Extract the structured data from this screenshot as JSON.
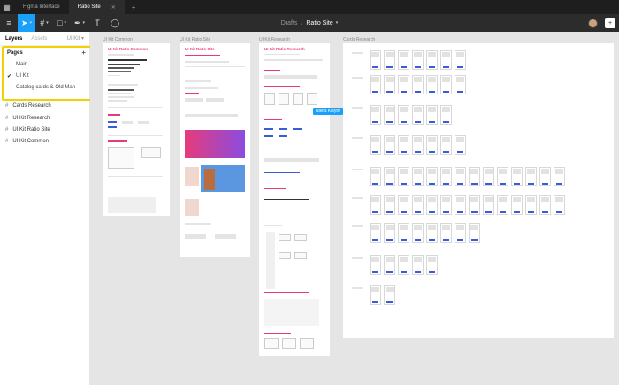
{
  "tabs": [
    {
      "label": "Figma Interface",
      "active": false
    },
    {
      "label": "Ratio Site",
      "active": true
    }
  ],
  "breadcrumb": {
    "project": "Drafts",
    "separator": "/",
    "file": "Ratio Site"
  },
  "layers_panel": {
    "tab_layers": "Layers",
    "tab_assets": "Assets",
    "page_dropdown": "UI Kit",
    "pages_header": "Pages",
    "pages": [
      "Main",
      "UI Kit",
      "Catalog cards & Old Man"
    ],
    "current_page": "UI Kit",
    "frames": [
      "Cards Research",
      "UI Kit Research",
      "UI Kit Ratio Site",
      "UI Kit Common"
    ]
  },
  "canvas": {
    "frame_labels": [
      "UI Kit Common",
      "UI Kit Ratio Site",
      "UI Kit Research",
      "Cards Research"
    ],
    "frame_titles": [
      "UI Kit Ratio Common",
      "UI Kit Ratio Site",
      "UI Kit Ratio Research"
    ],
    "cursor_name": "Nikita Kisylin"
  },
  "colors": {
    "accent": "#18a0fb",
    "highlight": "#f2d100",
    "brand_pink": "#e63b7a",
    "brand_blue": "#3c5bd6"
  }
}
